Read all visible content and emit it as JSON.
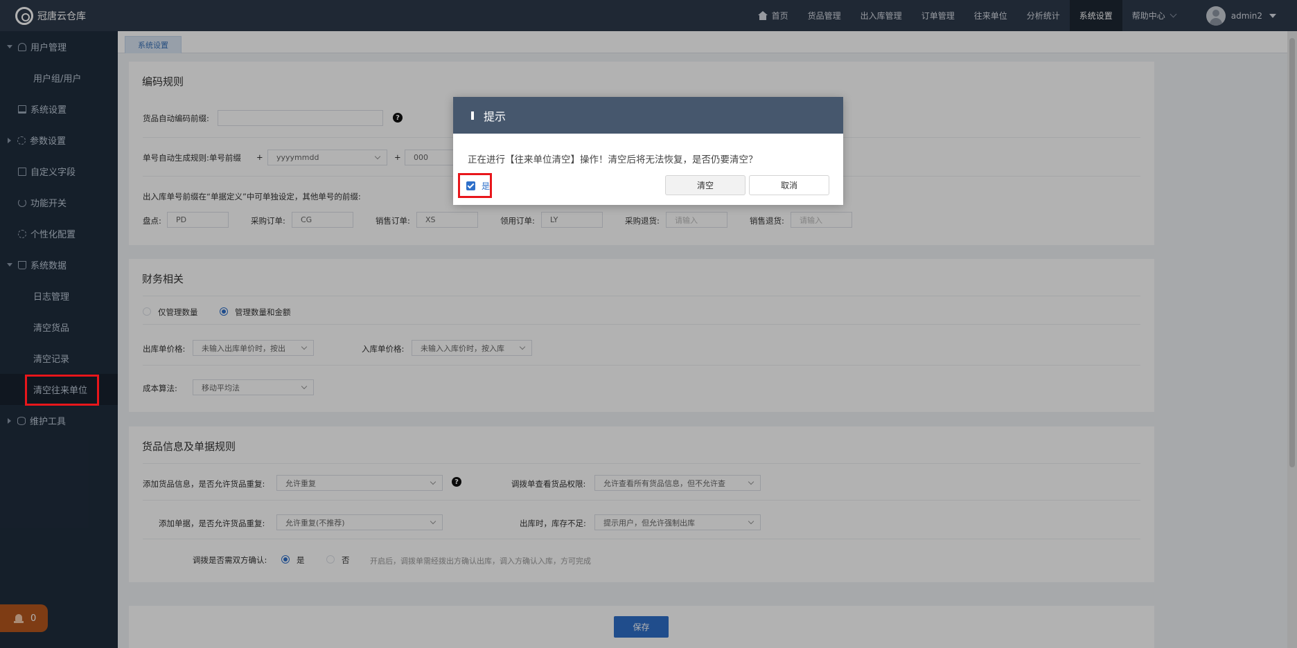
{
  "app": {
    "title": "冠唐云仓库"
  },
  "nav": {
    "items": [
      "首页",
      "货品管理",
      "出入库管理",
      "订单管理",
      "往来单位",
      "分析统计",
      "系统设置",
      "帮助中心"
    ],
    "active": "系统设置",
    "user": "admin2"
  },
  "sidebar": {
    "items": [
      {
        "label": "用户管理",
        "icon": "user-icon"
      },
      {
        "label": "用户组/用户"
      },
      {
        "label": "系统设置",
        "icon": "monitor-icon"
      },
      {
        "label": "参数设置",
        "icon": "gear-icon"
      },
      {
        "label": "自定义字段",
        "icon": "field-icon"
      },
      {
        "label": "功能开关",
        "icon": "power-icon"
      },
      {
        "label": "个性化配置",
        "icon": "gear-icon"
      },
      {
        "label": "系统数据",
        "icon": "cart-icon"
      },
      {
        "label": "日志管理"
      },
      {
        "label": "清空货品"
      },
      {
        "label": "清空记录"
      },
      {
        "label": "清空往来单位"
      },
      {
        "label": "维护工具",
        "icon": "db-icon"
      }
    ],
    "notification_count": "0"
  },
  "tab": {
    "label": "系统设置"
  },
  "coding": {
    "title": "编码规则",
    "goods_prefix_label": "货品自动编码前缀:",
    "order_rule_label": "单号自动生成规则:",
    "order_prefix_label": "单号前缀",
    "plus": "+",
    "date_format": "yyyymmdd",
    "serial": "000",
    "note": "出入库单号前缀在“单据定义”中可单独设定，其他单号的前缀:",
    "prefixes": [
      {
        "label": "盘点:",
        "value": "PD",
        "placeholder": ""
      },
      {
        "label": "采购订单:",
        "value": "CG",
        "placeholder": ""
      },
      {
        "label": "销售订单:",
        "value": "XS",
        "placeholder": ""
      },
      {
        "label": "领用订单:",
        "value": "LY",
        "placeholder": ""
      },
      {
        "label": "采购退货:",
        "value": "",
        "placeholder": "请输入"
      },
      {
        "label": "销售退货:",
        "value": "",
        "placeholder": "请输入"
      }
    ]
  },
  "finance": {
    "title": "财务相关",
    "radio1": "仅管理数量",
    "radio2": "管理数量和金额",
    "out_price_label": "出库单价格:",
    "out_price_value": "未输入出库单价时，按出",
    "in_price_label": "入库单价格:",
    "in_price_value": "未输入入库价时，按入库",
    "cost_label": "成本算法:",
    "cost_value": "移动平均法"
  },
  "goods_rules": {
    "title": "货品信息及单据规则",
    "add_goods_label": "添加货品信息，是否允许货品重复:",
    "add_goods_value": "允许重复",
    "transfer_view_label": "调拨单查看货品权限:",
    "transfer_view_value": "允许查看所有货品信息，但不允许查",
    "add_doc_label": "添加单据，是否允许货品重复:",
    "add_doc_value": "允许重复(不推荐)",
    "out_stock_label": "出库时，库存不足:",
    "out_stock_value": "提示用户，但允许强制出库",
    "confirm_label": "调拨是否需双方确认:",
    "yes": "是",
    "no": "否",
    "confirm_hint": "开启后，调拨单需经拨出方确认出库，调入方确认入库，方可完成"
  },
  "save_label": "保存",
  "dialog": {
    "title": "提示",
    "message": "正在进行【往来单位清空】操作！清空后将无法恢复，是否仍要清空？",
    "checkbox_label": "是",
    "confirm": "清空",
    "cancel": "取消"
  }
}
